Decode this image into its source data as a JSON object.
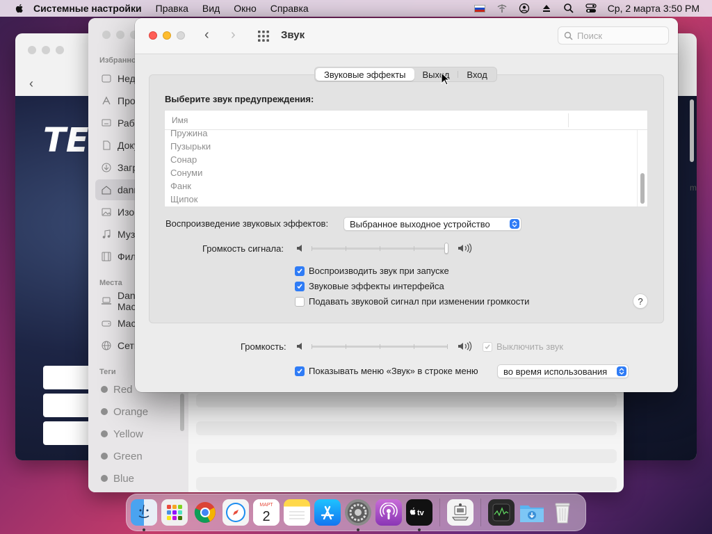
{
  "menubar": {
    "app_name": "Системные настройки",
    "items": [
      "Правка",
      "Вид",
      "Окно",
      "Справка"
    ],
    "clock": "Ср, 2 марта  3:50 PM"
  },
  "finder_bg": {
    "favorites_title": "Избранное",
    "favorites": [
      "Недавние",
      "Программы",
      "Рабочий стол",
      "Документы",
      "Загрузки",
      "danny",
      "Изображения",
      "Музыка",
      "Фильмы"
    ],
    "places_title": "Места",
    "places": [
      "Danny's MacBook",
      "Macintosh HD",
      "Сеть"
    ],
    "tags_title": "Теги",
    "tags": [
      "Red",
      "Orange",
      "Yellow",
      "Green",
      "Blue"
    ]
  },
  "bg_window": {
    "banner_text": "TEI",
    "side_letter": "m"
  },
  "sound_window": {
    "title": "Звук",
    "search_placeholder": "Поиск",
    "tabs": [
      {
        "label": "Звуковые эффекты",
        "active": true
      },
      {
        "label": "Выход",
        "active": false
      },
      {
        "label": "Вход",
        "active": false
      }
    ],
    "alert_label": "Выберите звук предупреждения:",
    "list_header": "Имя",
    "alert_sounds": [
      "Пружина",
      "Пузырьки",
      "Сонар",
      "Сонуми",
      "Фанк",
      "Щипок"
    ],
    "playback_label": "Воспроизведение звуковых эффектов:",
    "playback_device": "Выбранное выходное устройство",
    "alert_volume_label": "Громкость сигнала:",
    "alert_volume": 1.0,
    "checkboxes": [
      {
        "label": "Воспроизводить звук при запуске",
        "checked": true
      },
      {
        "label": "Звуковые эффекты интерфейса",
        "checked": true
      },
      {
        "label": "Подавать звуковой сигнал при изменении громкости",
        "checked": false
      }
    ],
    "help": "?",
    "volume_label": "Громкость:",
    "volume": 0.0,
    "mute_label": "Выключить звук",
    "mute_checked": true,
    "show_in_menubar_label": "Показывать меню «Звук» в строке меню",
    "show_in_menubar_checked": true,
    "show_in_menubar_option": "во время использования"
  },
  "dock": {
    "calendar_month": "МАРТ",
    "calendar_day": "2",
    "tv_label": "tv"
  },
  "colors": {
    "accent": "#2f7cf6",
    "close": "#ff5f57",
    "minimize": "#febc2e"
  }
}
